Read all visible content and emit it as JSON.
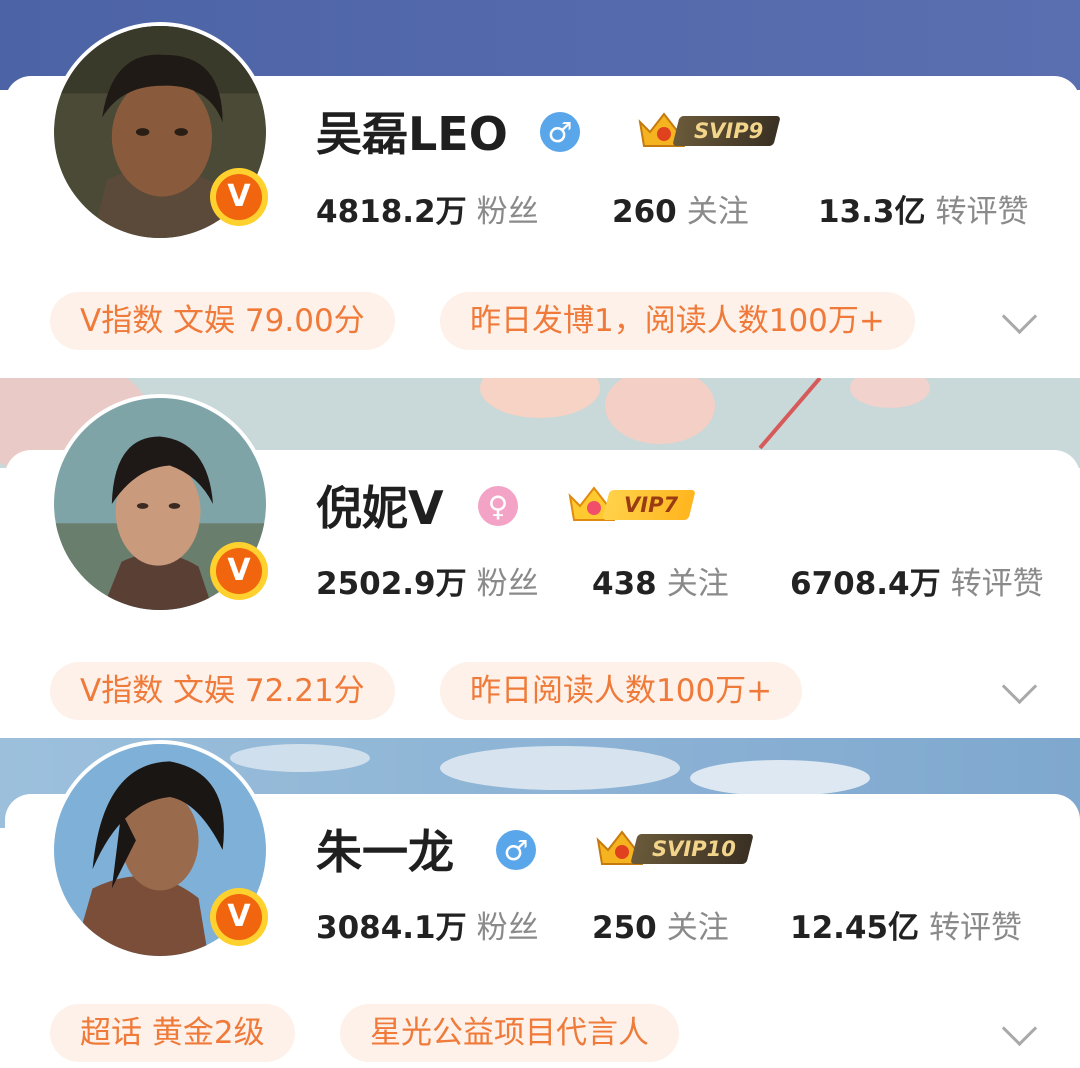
{
  "profiles": [
    {
      "name": "吴磊LEO",
      "gender": "male",
      "gender_icon": "♂",
      "vip_label": "SVIP9",
      "vip_style": "dark",
      "verified_badge": "V",
      "stats": [
        {
          "value": "4818.2万",
          "label": "粉丝"
        },
        {
          "value": "260",
          "label": "关注"
        },
        {
          "value": "13.3亿",
          "label": "转评赞"
        }
      ],
      "tags": [
        "V指数 文娱 79.00分",
        "昨日发博1，阅读人数100万+"
      ]
    },
    {
      "name": "倪妮V",
      "gender": "female",
      "gender_icon": "♀",
      "vip_label": "VIP7",
      "vip_style": "gold",
      "verified_badge": "V",
      "stats": [
        {
          "value": "2502.9万",
          "label": "粉丝"
        },
        {
          "value": "438",
          "label": "关注"
        },
        {
          "value": "6708.4万",
          "label": "转评赞"
        }
      ],
      "tags": [
        "V指数 文娱 72.21分",
        "昨日阅读人数100万+"
      ]
    },
    {
      "name": "朱一龙",
      "gender": "male",
      "gender_icon": "♂",
      "vip_label": "SVIP10",
      "vip_style": "dark",
      "verified_badge": "V",
      "stats": [
        {
          "value": "3084.1万",
          "label": "粉丝"
        },
        {
          "value": "250",
          "label": "关注"
        },
        {
          "value": "12.45亿",
          "label": "转评赞"
        }
      ],
      "tags": [
        "超话 黄金2级",
        "星光公益项目代言人"
      ]
    }
  ],
  "colors": {
    "tag_bg": "#fdf1e9",
    "tag_text": "#ef7a39",
    "male_icon": "#5aa6ea",
    "female_icon": "#f3a3c5",
    "verified_badge": "#f0650e"
  },
  "icons": [
    "male-gender-icon",
    "female-gender-icon",
    "crown-icon",
    "verified-v-icon",
    "chevron-down-icon"
  ]
}
